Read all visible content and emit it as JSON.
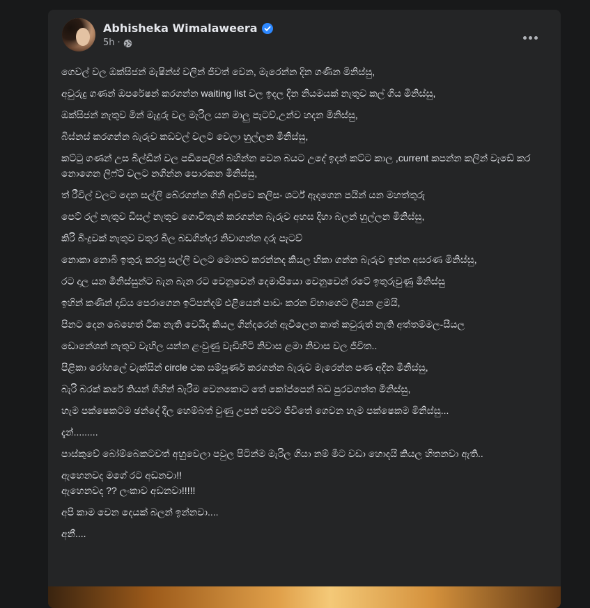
{
  "post": {
    "author": "Abhisheka Wimalaweera",
    "timestamp": "5h",
    "separator": "·",
    "verified": true,
    "privacy_icon": "globe-icon",
    "more_icon": "more-options-icon",
    "paragraphs": [
      "ගෙවල් වල ඔක්සිජන් මැෂින්ස් වලින් ජීවත් වෙන, මැරෙන්න දින ගණින මිනිස්සු,",
      "අවුරුදු ගණන් ඔපරේෂන් කරගන්න waiting list වල ඉදල දින නියමයක් නැතුව කල් ගිය මිනිස්සු,",
      "ඔක්සිජන් නැතුව මින් මැදුරු වල මැරිල යන මාලු පැටව්,උන්ව හදන මිනිස්සු,",
      "බිස්නස් කරගන්න බැරුව කඩවල් වලට වෙලා හුල්ලන මිනිස්සු,",
      "කට්ටු ගණන් උස බිල්ඩින් වල පඩිපෙලින් බහින්න වෙන බයට උදේ ඉදන් කට්ට කාල ,current කපන්න කලින් වැඩේ කර නොගෙන ලිෆ්ට් වලට නගින්න පොරකන මිනිස්සු,",
      "ත් රීවිල් වලට දෙන සල්ලි බේරගන්න ගිනි අව්වෙ කලිසං ශර්ට් ඇදගෙන පයින් යන මහත්තුරු",
      "පෙට් රල් නැතුව ඩීසල් නැතුව ගොවිතැන් කරගන්න බැරුව අහස දිහා බලන් හුල්ලන මිනිස්සු,",
      "කිරි බිංදුවක් නැතුව වතුර බීල බඩගින්දර නිවාගන්න දරු පැටව්",
      "නොකා නොබී ඉතුරු කරපු සල්ලි වලට මොනව කරන්නද කියල හිකා ගන්න බැරුව ඉන්න අසරණ මිනිස්සු,",
      "රට දාල යන මිනිස්සුන්ට බැන බැන රට වෙනුවෙන් දෙමාපියො වෙනුවෙන් රටේ ඉතුරුවුණු මිනිස්සු",
      "ඉහින් කණින් දාඩිය පෙරාගෙන ඉටිපන්දම් එළියෙන් පාඩං කරන විභාගෙට ලියන ළමයි,",
      "පිනට දෙන බෙහෙත් ටික නැති වෙයිද කියල ගින්දරෙන් ඇවිලෙන කාත් කවුරුත් නැති අත්තම්මල-සීයල",
      "ඩොනේශන් නැතුව වැහිල යන්න ළංවුණු වැඩිහිටි නිවාස ළමා නිවාස වල ජීවිත..",
      "පිළිකා රෝහලේ වැක්සින් circle එක සම්පූර්ණ කරගන්න බැරුව මැරෙන්න පණ අදින මිනිස්සු,",
      "බැරි බරක් කරේ තියන් ගිහින් බැරිම වෙනකොට තේ කෝප්පෙන් බඩ පුරවගත්ත මිනිස්සු,",
      "හැම පක්ෂෙකටම ඡන්දේ දීල හෙම්බත් වුණු උපන් පවට ජීවිතේ ගෙවන හැම පක්ෂෙකම මිනිස්සු...",
      "දැන්.........",
      "පාස්කුවේ බෝම්බෙකටවත් අහුවෙලා පවුල පිටින්ම මැරිල ගියා නම් මීට වඩා හොදයි කියල හිතනවා ඇති..",
      "ඇහෙනවද මගේ රට අඩනවා!!\nඇහෙනවද ?? ලංකාව අඩනවා!!!!!",
      "අපි කාම වෙන දෙයක් බලන් ඉන්නවා....",
      "අනී...."
    ]
  },
  "colors": {
    "background": "#18191a",
    "card": "#242526",
    "primary_text": "#e4e6eb",
    "secondary_text": "#b0b3b8",
    "verified_blue": "#2d88ff"
  }
}
